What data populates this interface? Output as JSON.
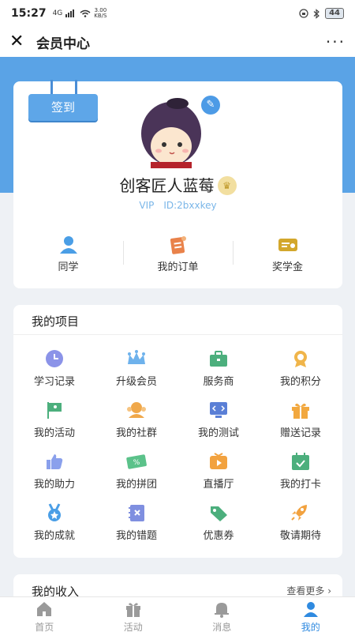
{
  "status": {
    "time": "15:27",
    "signal": "4G",
    "speed": "3.00",
    "speed_unit": "KB/S",
    "battery": "44"
  },
  "nav": {
    "title": "会员中心",
    "more": "···"
  },
  "profile": {
    "checkin_label": "签到",
    "username": "创客匠人蓝莓",
    "vip": "VIP",
    "user_id": "ID:2bxxkey",
    "quick": [
      {
        "label": "同学",
        "icon": "classmates-icon"
      },
      {
        "label": "我的订单",
        "icon": "orders-icon"
      },
      {
        "label": "奖学金",
        "icon": "scholarship-icon"
      }
    ]
  },
  "projects": {
    "title": "我的项目",
    "items": [
      {
        "label": "学习记录",
        "icon": "clock-icon"
      },
      {
        "label": "升级会员",
        "icon": "crown-icon"
      },
      {
        "label": "服务商",
        "icon": "briefcase-icon"
      },
      {
        "label": "我的积分",
        "icon": "medal-icon"
      },
      {
        "label": "我的活动",
        "icon": "flag-icon"
      },
      {
        "label": "我的社群",
        "icon": "community-icon"
      },
      {
        "label": "我的测试",
        "icon": "code-icon"
      },
      {
        "label": "赠送记录",
        "icon": "gift-icon"
      },
      {
        "label": "我的助力",
        "icon": "thumbs-up-icon"
      },
      {
        "label": "我的拼团",
        "icon": "coupon-percent-icon"
      },
      {
        "label": "直播厅",
        "icon": "live-play-icon"
      },
      {
        "label": "我的打卡",
        "icon": "calendar-check-icon"
      },
      {
        "label": "我的成就",
        "icon": "award-icon"
      },
      {
        "label": "我的错题",
        "icon": "notebook-x-icon"
      },
      {
        "label": "优惠券",
        "icon": "tag-icon"
      },
      {
        "label": "敬请期待",
        "icon": "rocket-icon"
      }
    ]
  },
  "income": {
    "title": "我的收入",
    "more": "查看更多 ›"
  },
  "tabbar": [
    {
      "label": "首页",
      "icon": "home-icon"
    },
    {
      "label": "活动",
      "icon": "gift-box-icon"
    },
    {
      "label": "消息",
      "icon": "bell-icon"
    },
    {
      "label": "我的",
      "icon": "person-icon"
    }
  ],
  "colors": {
    "brand": "#5aa3e6",
    "active_tab": "#2f8ae0"
  }
}
